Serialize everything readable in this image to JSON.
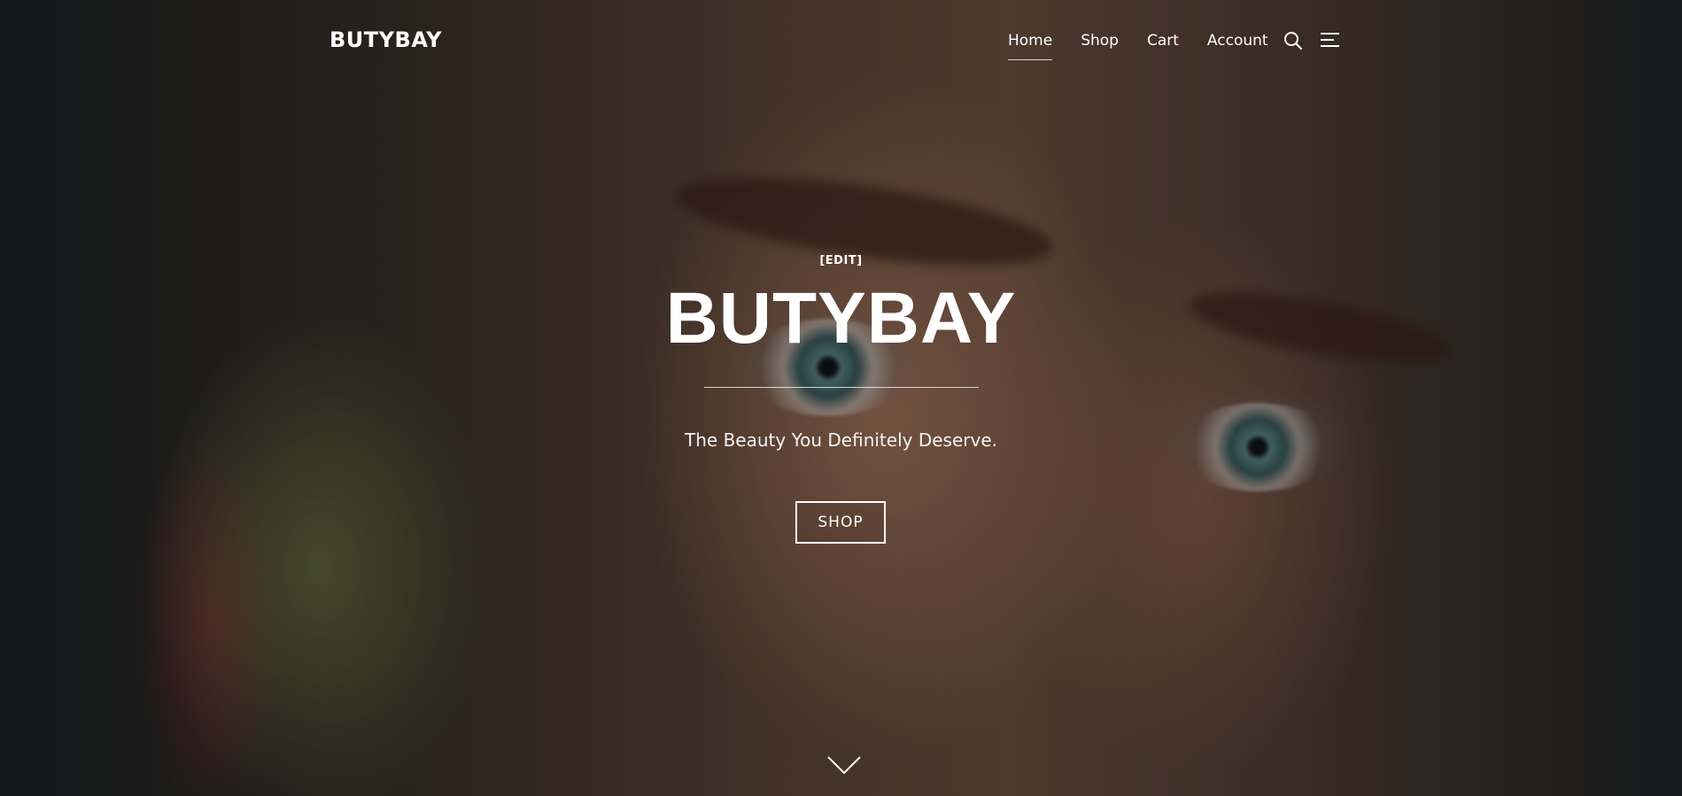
{
  "header": {
    "logo": "BUTYBAY",
    "nav": [
      {
        "label": "Home",
        "active": true
      },
      {
        "label": "Shop",
        "active": false
      },
      {
        "label": "Cart",
        "active": false
      },
      {
        "label": "Account",
        "active": false
      }
    ],
    "icons": [
      "search-icon",
      "menu-icon"
    ]
  },
  "hero": {
    "edit_link": "[EDIT]",
    "title": "BUTYBAY",
    "tagline": "The Beauty You Definitely Deserve.",
    "button_label": "SHOP",
    "scroll_icon": "chevron-down-icon"
  },
  "colors": {
    "text": "#ffffff",
    "overlay": "#000000"
  }
}
